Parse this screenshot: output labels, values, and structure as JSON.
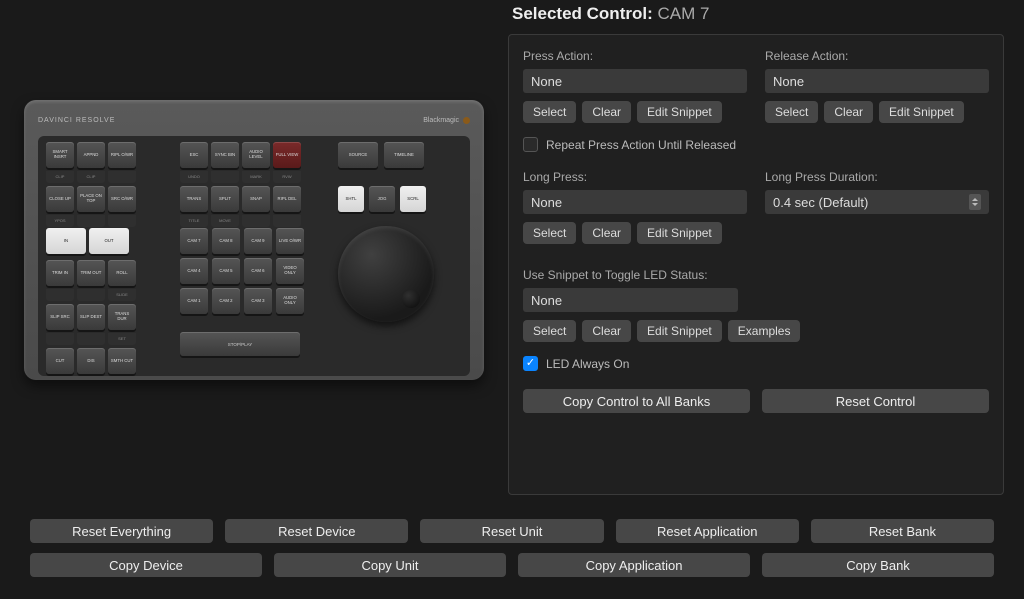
{
  "header": {
    "title_prefix": "Selected Control:",
    "title_value": "CAM 7"
  },
  "press": {
    "label": "Press Action:",
    "value": "None",
    "select": "Select",
    "clear": "Clear",
    "edit": "Edit Snippet"
  },
  "release": {
    "label": "Release Action:",
    "value": "None",
    "select": "Select",
    "clear": "Clear",
    "edit": "Edit Snippet"
  },
  "repeat": {
    "label": "Repeat Press Action Until Released",
    "checked": false
  },
  "longpress": {
    "label": "Long Press:",
    "value": "None",
    "select": "Select",
    "clear": "Clear",
    "edit": "Edit Snippet"
  },
  "duration": {
    "label": "Long Press Duration:",
    "value": "0.4 sec (Default)"
  },
  "led": {
    "label": "Use Snippet to Toggle LED Status:",
    "value": "None",
    "select": "Select",
    "clear": "Clear",
    "edit": "Edit Snippet",
    "examples": "Examples"
  },
  "led_always": {
    "label": "LED Always On",
    "checked": true
  },
  "big": {
    "copy": "Copy Control to All Banks",
    "reset": "Reset Control"
  },
  "bottom": {
    "row1": [
      "Reset Everything",
      "Reset Device",
      "Reset Unit",
      "Reset Application",
      "Reset Bank"
    ],
    "row2": [
      "Copy Device",
      "Copy Unit",
      "Copy Application",
      "Copy Bank"
    ]
  },
  "device": {
    "brand": "DAVINCI RESOLVE",
    "maker": "Blackmagic",
    "group1_row1": [
      "SMART INSRT",
      "APPND",
      "RIPL O/WR"
    ],
    "group1_sub1": [
      "CLIP",
      "CLIP",
      ""
    ],
    "group1_row2": [
      "CLOSE UP",
      "PLACE ON TOP",
      "SRC O/WR"
    ],
    "group1_sub2": [
      "YPOS",
      "",
      ""
    ],
    "in": "IN",
    "out": "OUT",
    "group2_row1": [
      "TRIM IN",
      "TRIM OUT",
      "ROLL"
    ],
    "group2_sub1": [
      "",
      "",
      "SLIDE"
    ],
    "group2_row2": [
      "SLIP SRC",
      "SLIP DEST",
      "TRANS DUR"
    ],
    "group2_sub2": [
      "",
      "",
      "SET"
    ],
    "group2_row3": [
      "CUT",
      "DIS",
      "SMTH CUT"
    ],
    "center_row1": [
      "ESC",
      "SYNC BIN",
      "AUDIO LEVEL",
      "FULL VIEW"
    ],
    "center_sub1": [
      "UNDO",
      "",
      "MARK",
      "RVW"
    ],
    "center_row2": [
      "TRANS",
      "SPLIT",
      "SNAP",
      "RIPL DEL"
    ],
    "center_sub2": [
      "TITLE",
      "MOVE",
      "",
      ""
    ],
    "cam_row1": [
      "CAM 7",
      "CAM 8",
      "CAM 9",
      "LIVE O/WR"
    ],
    "cam_row2": [
      "CAM 4",
      "CAM 5",
      "CAM 6",
      "VIDEO ONLY"
    ],
    "cam_row3": [
      "CAM 1",
      "CAM 2",
      "CAM 3",
      "AUDIO ONLY"
    ],
    "spacebar": "STOP/PLAY",
    "right_row1": [
      "SOURCE",
      "TIMELINE"
    ],
    "right_row2": [
      "SHTL",
      "JOG",
      "SCRL"
    ]
  }
}
